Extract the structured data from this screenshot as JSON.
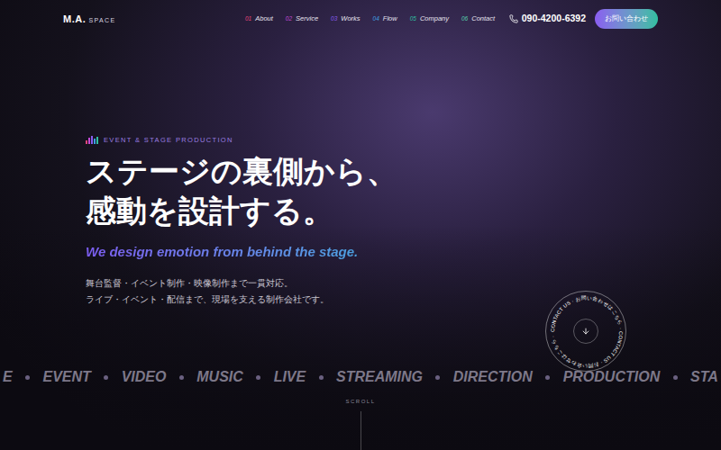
{
  "header": {
    "logo_main": "M.A.",
    "logo_sub": "SPACE",
    "nav": [
      {
        "number": "01",
        "label": "About",
        "color": "#e0457b"
      },
      {
        "number": "02",
        "label": "Service",
        "color": "#c44ad4"
      },
      {
        "number": "03",
        "label": "Works",
        "color": "#8a5cf0"
      },
      {
        "number": "04",
        "label": "Flow",
        "color": "#3f9ee0"
      },
      {
        "number": "05",
        "label": "Company",
        "color": "#2fbfa0"
      },
      {
        "number": "06",
        "label": "Contact",
        "color": "#55cfae"
      }
    ],
    "phone": "090-4200-6392",
    "contact_button": "お問い合わせ"
  },
  "hero": {
    "eyebrow": "EVENT & STAGE PRODUCTION",
    "heading_lines": [
      "ステージの裏側から、",
      "感動を設計する。"
    ],
    "subtitle": "We design emotion from behind the stage.",
    "body_lines": [
      "舞台監督・イベント制作・映像制作まで一貫対応。",
      "ライブ・イベント・配信まで、現場を支える制作会社です。"
    ]
  },
  "badge": {
    "text": "CONTACT US · お問い合わせはこちら · CONTACT US · お問い合わせはこちら ·"
  },
  "marquee": [
    "E",
    "EVENT",
    "VIDEO",
    "MUSIC",
    "LIVE",
    "STREAMING",
    "DIRECTION",
    "PRODUCTION",
    "STA"
  ],
  "scroll": "SCROLL"
}
